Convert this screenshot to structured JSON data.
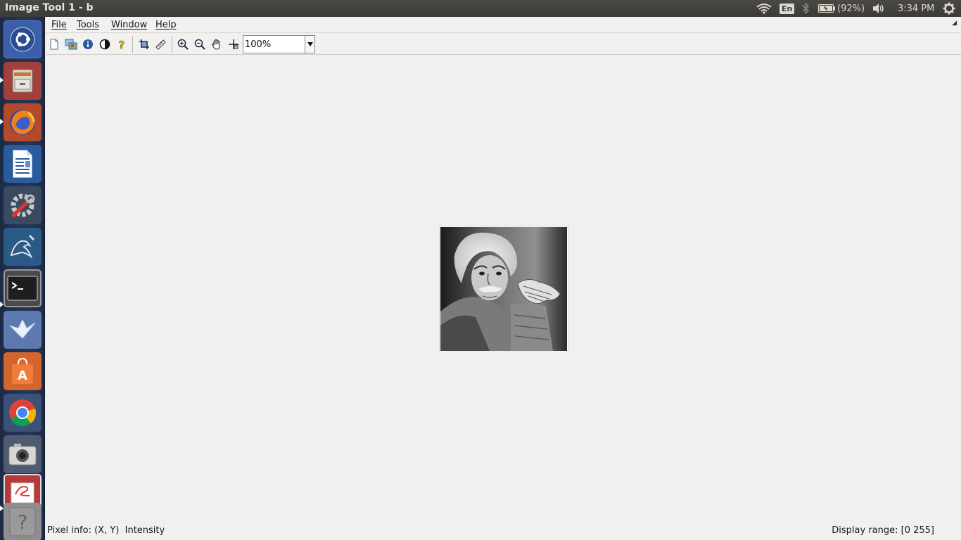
{
  "window": {
    "title": "Image Tool 1 - b"
  },
  "tray": {
    "keyboard_layout": "En",
    "battery": "(92%)",
    "clock": "3:34 PM",
    "icons": [
      "wifi-icon",
      "bluetooth-icon",
      "battery-icon",
      "volume-icon",
      "settings-gear-icon"
    ]
  },
  "launcher": {
    "items": [
      {
        "name": "ubuntu-dash"
      },
      {
        "name": "files"
      },
      {
        "name": "firefox"
      },
      {
        "name": "libreoffice-writer"
      },
      {
        "name": "system-settings"
      },
      {
        "name": "mysql-workbench"
      },
      {
        "name": "terminal"
      },
      {
        "name": "mail-app"
      },
      {
        "name": "ubuntu-software"
      },
      {
        "name": "chrome"
      },
      {
        "name": "screenshot"
      },
      {
        "name": "document-viewer"
      },
      {
        "name": "help"
      }
    ]
  },
  "menubar": {
    "items": [
      {
        "label": "File"
      },
      {
        "label": "Tools"
      },
      {
        "label": "Window"
      },
      {
        "label": "Help"
      }
    ]
  },
  "toolbar": {
    "buttons": [
      "new-figure-icon",
      "image-copy-icon",
      "info-icon",
      "contrast-icon",
      "help-icon",
      "crop-icon",
      "measure-icon",
      "zoom-in-icon",
      "zoom-out-icon",
      "pan-hand-icon",
      "pixel-region-icon"
    ],
    "zoom_value": "100%"
  },
  "status": {
    "pixel_info": "Pixel info: (X, Y)  Intensity",
    "display_range": "Display range: [0 255]"
  }
}
